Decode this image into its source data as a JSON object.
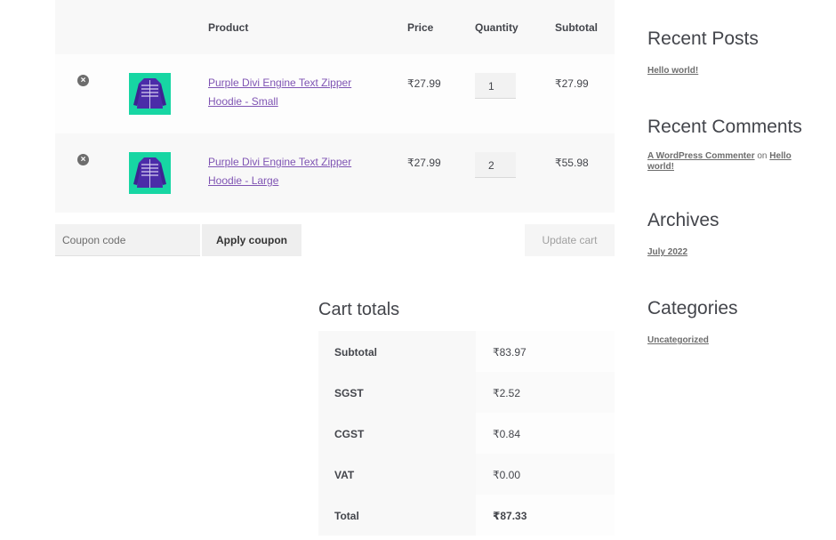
{
  "cart": {
    "headers": {
      "product": "Product",
      "price": "Price",
      "quantity": "Quantity",
      "subtotal": "Subtotal"
    },
    "items": [
      {
        "remove_icon": "close-circle-icon",
        "name_line1": "Purple Divi Engine Text Zipper",
        "name_line2": "Hoodie - Small",
        "price": "₹27.99",
        "quantity": "1",
        "subtotal": "₹27.99"
      },
      {
        "remove_icon": "close-circle-icon",
        "name_line1": "Purple Divi Engine Text Zipper",
        "name_line2": "Hoodie - Large",
        "price": "₹27.99",
        "quantity": "2",
        "subtotal": "₹55.98"
      }
    ],
    "coupon_placeholder": "Coupon code",
    "apply_coupon_label": "Apply coupon",
    "update_cart_label": "Update cart"
  },
  "totals": {
    "title": "Cart totals",
    "rows": [
      {
        "label": "Subtotal",
        "value": "₹83.97"
      },
      {
        "label": "SGST",
        "value": "₹2.52"
      },
      {
        "label": "CGST",
        "value": "₹0.84"
      },
      {
        "label": "VAT",
        "value": "₹0.00"
      },
      {
        "label": "Total",
        "value": "₹87.33"
      }
    ]
  },
  "sidebar": {
    "recent_posts": {
      "title": "Recent Posts",
      "items": [
        "Hello world!"
      ]
    },
    "recent_comments": {
      "title": "Recent Comments",
      "author": "A WordPress Commenter",
      "on": "on",
      "post": "Hello world!"
    },
    "archives": {
      "title": "Archives",
      "items": [
        "July 2022"
      ]
    },
    "categories": {
      "title": "Categories",
      "items": [
        "Uncategorized"
      ]
    }
  },
  "colors": {
    "product_thumb_bg": "#17d6a3",
    "hoodie": "#4b2ca8",
    "link": "#7f54b3"
  }
}
